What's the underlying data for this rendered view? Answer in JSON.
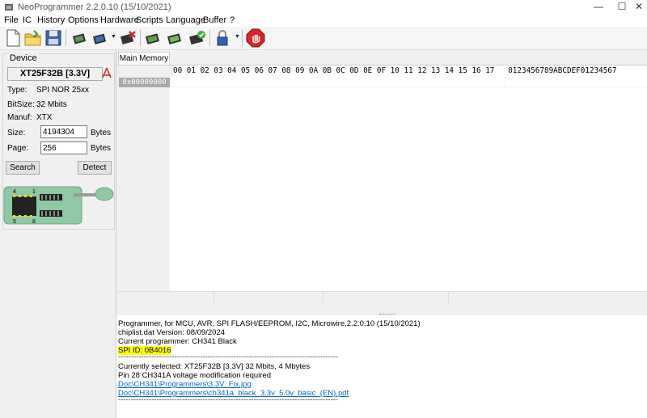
{
  "window": {
    "title": "NeoProgrammer 2.2.0.10 (15/10/2021)",
    "minimize": "—",
    "maximize": "☐",
    "close": "✕"
  },
  "menu": [
    "File",
    "IC",
    "History",
    "Options",
    "Hardware",
    "Scripts",
    "Language",
    "Buffer",
    "?"
  ],
  "device": {
    "group_label": "Device",
    "name": "XT25F32B [3.3V]",
    "type_label": "Type:",
    "type_value": "SPI NOR 25xx",
    "bitsize_label": "BitSize:",
    "bitsize_value": "32 Mbits",
    "manuf_label": "Manuf:",
    "manuf_value": "XTX",
    "size_label": "Size:",
    "size_value": "4194304",
    "size_unit": "Bytes",
    "page_label": "Page:",
    "page_value": "256",
    "page_unit": "Bytes",
    "search_button": "Search",
    "detect_button": "Detect",
    "chip_pin4": "4",
    "chip_pin1": "1",
    "chip_pin5": "5",
    "chip_pin8": "8"
  },
  "main": {
    "tab": "Main Memory",
    "hex_header": "00 01 02 03 04 05 06 07 08 09 0A 0B 0C 0D 0E 0F 10 11 12 13 14 15 16 17   0123456789ABCDEF01234567",
    "first_address": "0x00000000"
  },
  "log": {
    "line1": "Programmer, for MCU, AVR, SPI FLASH/EEPROM, I2C, Microwire,2.2.0.10 (15/10/2021)",
    "line2": "chiplist.dat Version: 08/09/2024",
    "line3": "Current programmer: CH341 Black",
    "line4": "SPI ID: 0B4016",
    "separator": "--------------------------------------------------------------------------------------",
    "line5": "Currently selected:  XT25F32B [3.3V] 32 Mbits, 4 Mbytes",
    "line6": "Pin 28 CH341A voltage modification required",
    "link1": "Doc\\CH341\\Programmers\\3.3V_Fix.jpg",
    "link2": "Doc\\CH341\\Programmers\\ch341a_black_3.3v_5.0v_basic_(EN).pdf"
  },
  "colors": {
    "highlight": "#ffff00",
    "link": "#0066cc",
    "stop_red": "#d9262c",
    "chip_board": "#8fc9a3"
  }
}
